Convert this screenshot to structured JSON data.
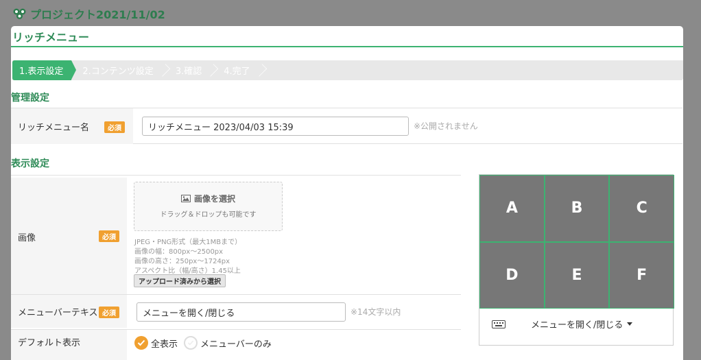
{
  "project": {
    "title": "プロジェクト2021/11/02"
  },
  "modal": {
    "title": "リッチメニュー"
  },
  "steps": [
    {
      "label": "1.表示設定",
      "active": true
    },
    {
      "label": "2.コンテンツ設定",
      "active": false
    },
    {
      "label": "3.確認",
      "active": false
    },
    {
      "label": "4.完了",
      "active": false
    }
  ],
  "management": {
    "section_title": "管理設定",
    "name_label": "リッチメニュー名",
    "required_label": "必須",
    "name_value": "リッチメニュー 2023/04/03 15:39",
    "name_hint": "※公開されません"
  },
  "display": {
    "section_title": "表示設定",
    "image_label": "画像",
    "required_label": "必須",
    "dropzone_title": "画像を選択",
    "dropzone_sub": "ドラッグ＆ドロップも可能です",
    "spec_lines": [
      "JPEG・PNG形式（最大1MBまで）",
      "画像の幅：800px～2500px",
      "画像の高さ：250px～1724px",
      "アスペクト比（幅/高さ）1.45以上"
    ],
    "upload_button": "アップロード済みから選択",
    "menubar_label": "メニューバーテキスト",
    "menubar_value": "メニューを開く/閉じる",
    "menubar_hint": "※14文字以内",
    "default_label": "デフォルト表示",
    "default_options": [
      "全表示",
      "メニューバーのみ"
    ],
    "default_selected": "全表示"
  },
  "preview": {
    "cells": [
      "A",
      "B",
      "C",
      "D",
      "E",
      "F"
    ],
    "menubar_text": "メニューを開く/閉じる",
    "accent": "#3cb371"
  },
  "colors": {
    "primary": "#3cb371",
    "required": "#f0a030",
    "title": "#2e8b57"
  }
}
